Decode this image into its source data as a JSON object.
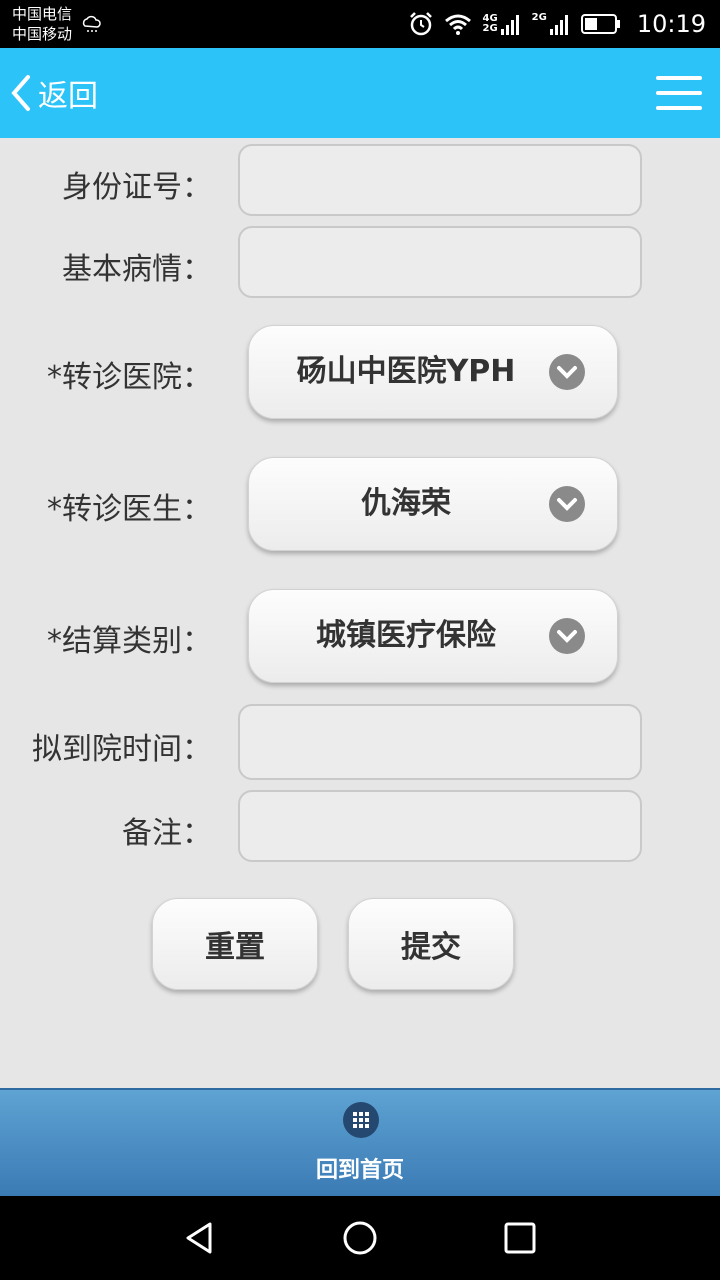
{
  "status_bar": {
    "carrier_1": "中国电信",
    "carrier_2": "中国移动",
    "network_1": "4G",
    "network_2": "2G",
    "network_3": "2G",
    "time": "10:19"
  },
  "header": {
    "back_label": "返回",
    "icons": [
      "chevron-left-icon",
      "menu-icon"
    ]
  },
  "form": {
    "id_number_label": "身份证号：",
    "id_number_value": "",
    "condition_label": "基本病情：",
    "condition_value": "",
    "hospital_label": "*转诊医院：",
    "hospital_value": "砀山中医院YPH",
    "doctor_label": "*转诊医生：",
    "doctor_value": "仇海荣",
    "settlement_label": "*结算类别：",
    "settlement_value": "城镇医疗保险",
    "arrival_time_label": "拟到院时间：",
    "arrival_time_value": "",
    "remark_label": "备注：",
    "remark_value": ""
  },
  "buttons": {
    "reset": "重置",
    "submit": "提交"
  },
  "bottom_nav": {
    "home_label": "回到首页"
  },
  "colors": {
    "header_bg": "#2cc3f9",
    "page_bg": "#e6e6e6",
    "bottom_bar": "#4a8cc4"
  }
}
